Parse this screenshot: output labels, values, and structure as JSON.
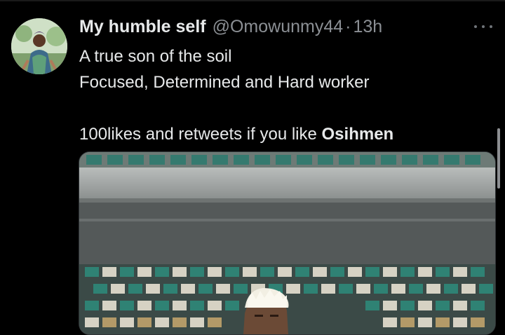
{
  "tweet": {
    "author_name": "My humble self",
    "handle": "@Omowunmy44",
    "separator": "·",
    "time": "13h",
    "lines": [
      "A true son of the soil",
      "Focused, Determined and Hard worker"
    ],
    "cta_prefix": "100likes and retweets if you like ",
    "cta_bold": "Osihmen"
  },
  "icons": {
    "more": "more-horizontal-icon",
    "avatar": "profile-avatar"
  },
  "colors": {
    "background": "#000000",
    "text_primary": "#e7e9ea",
    "text_secondary": "#8b8f94",
    "media_border": "#2f3336"
  }
}
